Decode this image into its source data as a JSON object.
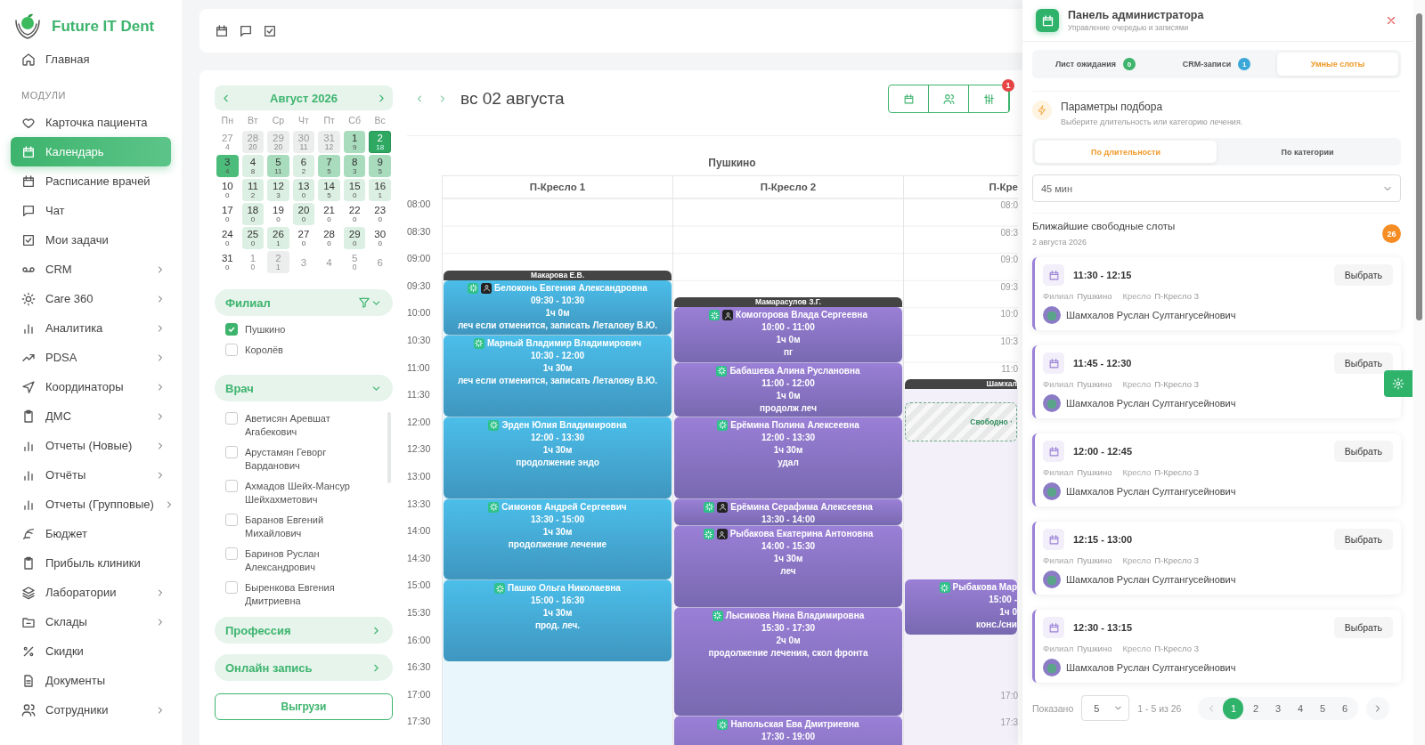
{
  "sidebar": {
    "logo_text": "Future IT Dent",
    "home_item": {
      "label": "Главная",
      "selected": false
    },
    "section_label": "МОДУЛИ",
    "items": [
      {
        "label": "Карточка пациента",
        "selected": false,
        "expandable": false
      },
      {
        "label": "Календарь",
        "selected": true,
        "expandable": false
      },
      {
        "label": "Расписание врачей",
        "selected": false,
        "expandable": false
      },
      {
        "label": "Чат",
        "selected": false,
        "expandable": false
      },
      {
        "label": "Мои задачи",
        "selected": false,
        "expandable": false
      },
      {
        "label": "CRM",
        "selected": false,
        "expandable": true
      },
      {
        "label": "Care 360",
        "selected": false,
        "expandable": true
      },
      {
        "label": "Аналитика",
        "selected": false,
        "expandable": true
      },
      {
        "label": "PDSA",
        "selected": false,
        "expandable": true
      },
      {
        "label": "Координаторы",
        "selected": false,
        "expandable": true
      },
      {
        "label": "ДМС",
        "selected": false,
        "expandable": true
      },
      {
        "label": "Отчеты (Новые)",
        "selected": false,
        "expandable": true
      },
      {
        "label": "Отчёты",
        "selected": false,
        "expandable": true
      },
      {
        "label": "Отчеты (Групповые)",
        "selected": false,
        "expandable": true
      },
      {
        "label": "Бюджет",
        "selected": false,
        "expandable": false
      },
      {
        "label": "Прибыль клиники",
        "selected": false,
        "expandable": false
      },
      {
        "label": "Лаборатории",
        "selected": false,
        "expandable": true
      },
      {
        "label": "Склады",
        "selected": false,
        "expandable": true
      },
      {
        "label": "Скидки",
        "selected": false,
        "expandable": false
      },
      {
        "label": "Документы",
        "selected": false,
        "expandable": false
      },
      {
        "label": "Сотрудники",
        "selected": false,
        "expandable": true
      }
    ]
  },
  "filters": {
    "calendar": {
      "month": "Август 2026",
      "weekdays": [
        "Пн",
        "Вт",
        "Ср",
        "Чт",
        "Пт",
        "Сб",
        "Вс"
      ],
      "days": [
        {
          "day": "27",
          "count": "4",
          "outside": true,
          "selected": false
        },
        {
          "day": "28",
          "count": "20",
          "color": "#eceeed",
          "outside": true,
          "selected": false
        },
        {
          "day": "29",
          "count": "20",
          "color": "#eceeed",
          "outside": true,
          "selected": false
        },
        {
          "day": "30",
          "count": "11",
          "color": "#eceeed",
          "outside": true,
          "selected": false
        },
        {
          "day": "31",
          "count": "12",
          "color": "#eceeed",
          "outside": true,
          "selected": false
        },
        {
          "day": "1",
          "count": "9",
          "color": "#a9dbbd",
          "outside": false,
          "selected": false
        },
        {
          "day": "2",
          "count": "18",
          "color": "#2fa862",
          "outside": false,
          "selected": true
        },
        {
          "day": "3",
          "count": "4",
          "color": "#4cbc7b",
          "outside": false,
          "selected": false
        },
        {
          "day": "4",
          "count": "8",
          "color": "#dcefe3",
          "outside": false,
          "selected": false
        },
        {
          "day": "5",
          "count": "11",
          "color": "#a9dbbd",
          "outside": false,
          "selected": false
        },
        {
          "day": "6",
          "count": "2",
          "color": "#dcefe3",
          "outside": false,
          "selected": false
        },
        {
          "day": "7",
          "count": "5",
          "color": "#a9dbbd",
          "outside": false,
          "selected": false
        },
        {
          "day": "8",
          "count": "3",
          "color": "#a9dbbd",
          "outside": false,
          "selected": false
        },
        {
          "day": "9",
          "count": "5",
          "color": "#a9dbbd",
          "outside": false,
          "selected": false
        },
        {
          "day": "10",
          "count": "0",
          "outside": false,
          "selected": false
        },
        {
          "day": "11",
          "count": "2",
          "color": "#dcefe3",
          "outside": false,
          "selected": false
        },
        {
          "day": "12",
          "count": "3",
          "color": "#dcefe3",
          "outside": false,
          "selected": false
        },
        {
          "day": "13",
          "count": "0",
          "color": "#dcefe3",
          "outside": false,
          "selected": false
        },
        {
          "day": "14",
          "count": "5",
          "color": "#dcefe3",
          "outside": false,
          "selected": false
        },
        {
          "day": "15",
          "count": "0",
          "color": "#dcefe3",
          "outside": false,
          "selected": false
        },
        {
          "day": "16",
          "count": "1",
          "color": "#dcefe3",
          "outside": false,
          "selected": false
        },
        {
          "day": "17",
          "count": "0",
          "outside": false,
          "selected": false
        },
        {
          "day": "18",
          "count": "0",
          "color": "#dcefe3",
          "outside": false,
          "selected": false
        },
        {
          "day": "19",
          "count": "0",
          "outside": false,
          "selected": false
        },
        {
          "day": "20",
          "count": "0",
          "color": "#dcefe3",
          "outside": false,
          "selected": false
        },
        {
          "day": "21",
          "count": "0",
          "outside": false,
          "selected": false
        },
        {
          "day": "22",
          "count": "0",
          "outside": false,
          "selected": false
        },
        {
          "day": "23",
          "count": "0",
          "outside": false,
          "selected": false
        },
        {
          "day": "24",
          "count": "0",
          "outside": false,
          "selected": false
        },
        {
          "day": "25",
          "count": "0",
          "color": "#dcefe3",
          "outside": false,
          "selected": false
        },
        {
          "day": "26",
          "count": "1",
          "color": "#dcefe3",
          "outside": false,
          "selected": false
        },
        {
          "day": "27",
          "count": "0",
          "outside": false,
          "selected": false
        },
        {
          "day": "28",
          "count": "0",
          "outside": false,
          "selected": false
        },
        {
          "day": "29",
          "count": "0",
          "color": "#dcefe3",
          "outside": false,
          "selected": false
        },
        {
          "day": "30",
          "count": "0",
          "outside": false,
          "selected": false
        },
        {
          "day": "31",
          "count": "0",
          "outside": false,
          "selected": false
        },
        {
          "day": "1",
          "count": "0",
          "outside": true,
          "selected": false
        },
        {
          "day": "2",
          "count": "1",
          "color": "#eceeed",
          "outside": true,
          "selected": false
        },
        {
          "day": "3",
          "outside": true,
          "selected": false
        },
        {
          "day": "4",
          "outside": true,
          "selected": false
        },
        {
          "day": "5",
          "count": "0",
          "outside": true,
          "selected": false
        },
        {
          "day": "6",
          "outside": true,
          "selected": false
        }
      ]
    },
    "branch": {
      "title": "Филиал",
      "options": [
        {
          "label": "Пушкино",
          "checked": true
        },
        {
          "label": "Королёв",
          "checked": false
        }
      ]
    },
    "doctor": {
      "title": "Врач",
      "options": [
        {
          "label": "Аветисян Аревшат Агабекович",
          "checked": false
        },
        {
          "label": "Арустамян Геворг Варданович",
          "checked": false
        },
        {
          "label": "Ахмадов Шейх-Мансур Шейхахметович",
          "checked": false
        },
        {
          "label": "Баранов Евгений Михайлович",
          "checked": false
        },
        {
          "label": "Баринов Руслан Александрович",
          "checked": false
        },
        {
          "label": "Быренкова Евгения Дмитриевна",
          "checked": false
        }
      ]
    },
    "sections": [
      "Профессия",
      "Онлайн запись"
    ],
    "export_button": "Выгрузи"
  },
  "calendar": {
    "title": "вс 02 августа",
    "filter_badge": "1",
    "branch": "Пушкино",
    "time_labels": [
      "08:00",
      "08:30",
      "09:00",
      "09:30",
      "10:00",
      "10:30",
      "11:00",
      "11:30",
      "12:00",
      "12:30",
      "13:00",
      "13:30",
      "14:00",
      "14:30",
      "15:00",
      "15:30",
      "16:00",
      "16:30",
      "17:00",
      "17:30"
    ],
    "columns": [
      {
        "name": "П-Кресло 1",
        "color": "#4bbeea",
        "appointments": [
          {
            "kind": "appointment",
            "doctor": "Макарова Е.В.",
            "name": "Белоконь Евгения Александровна",
            "person_icon": true,
            "time": "09:30 - 10:30",
            "duration": "1ч 0м",
            "note": "леч если отменится, записать Леталову В.Ю."
          },
          {
            "kind": "appointment",
            "name": "Марный Владимир Владимирович",
            "person_icon": false,
            "time": "10:30 - 12:00",
            "duration": "1ч 30м",
            "note": "леч если отменится, записать Леталову В.Ю."
          },
          {
            "kind": "appointment",
            "name": "Эрден Юлия Владимировна",
            "person_icon": false,
            "time": "12:00 - 13:30",
            "duration": "1ч 30м",
            "note": "продолжение эндо"
          },
          {
            "kind": "appointment",
            "name": "Симонов Андрей Сергеевич",
            "person_icon": false,
            "time": "13:30 - 15:00",
            "duration": "1ч 30м",
            "note": "продолжение лечение"
          },
          {
            "kind": "appointment",
            "name": "Пашко Ольга Николаевна",
            "person_icon": false,
            "time": "15:00 - 16:30",
            "duration": "1ч 30м",
            "note": "прод. леч."
          }
        ]
      },
      {
        "name": "П-Кресло 2",
        "color": "#9a7fd6",
        "appointments": [
          {
            "kind": "appointment",
            "doctor": "Мамарасулов З.Г.",
            "name": "Комогорова Влада Сергеевна",
            "person_icon": true,
            "time": "10:00 - 11:00",
            "duration": "1ч 0м",
            "note": "пг"
          },
          {
            "kind": "appointment",
            "name": "Бабашева Алина Руслановна",
            "person_icon": false,
            "time": "11:00 - 12:00",
            "duration": "1ч 0м",
            "note": "продолж леч"
          },
          {
            "kind": "appointment",
            "name": "Ерёмина Полина Алексеевна",
            "person_icon": false,
            "time": "12:00 - 13:30",
            "duration": "1ч 30м",
            "note": "удал"
          },
          {
            "kind": "appointment",
            "name": "Ерёмина Серафима Алексеевна",
            "person_icon": true,
            "time": "13:30 - 14:00"
          },
          {
            "kind": "appointment",
            "name": "Рыбакова Екатерина Антоновна",
            "person_icon": true,
            "time": "14:00 - 15:30",
            "duration": "1ч 30м",
            "note": "леч"
          },
          {
            "kind": "appointment",
            "name": "Лысикова Нина Владимировна",
            "person_icon": false,
            "time": "15:30 - 17:30",
            "duration": "2ч 0м",
            "note": "продолжение лечения, скол фронта"
          },
          {
            "kind": "appointment",
            "name": "Напольская Ева Дмитриевна",
            "person_icon": false,
            "time": "17:30 - 19:00"
          }
        ]
      },
      {
        "name": "П-Кре",
        "color": "#9a7fd6",
        "time_marks_top": [
          "08:0",
          "08:3",
          "09:0",
          "09:3",
          "10:0",
          "10:3",
          "11:0"
        ],
        "time_marks_bottom": [
          "17:0",
          "17:3"
        ],
        "appointments": [
          {
            "kind": "free",
            "doctor": "Шамхал",
            "label": "Свободно ·"
          },
          {
            "kind": "appointment",
            "name": "Рыбакова Мар",
            "person_icon": false,
            "time": "15:00 -",
            "duration": "1ч 0",
            "note": "конс./сни"
          }
        ]
      }
    ]
  },
  "panel": {
    "title": "Панель администратора",
    "subtitle": "Управление очередью и записями",
    "tabs": [
      {
        "label": "Лист ожидания",
        "count": "0",
        "color": "#3fb46d",
        "selected": false
      },
      {
        "label": "CRM-записи",
        "count": "1",
        "color": "#3aa7d8",
        "selected": false
      },
      {
        "label": "Умные слоты",
        "selected": true
      }
    ],
    "params_title": "Параметры подбора",
    "params_subtitle": "Выберите длительность или категорию лечения.",
    "modes": [
      {
        "label": "По длительности",
        "selected": true
      },
      {
        "label": "По категории",
        "selected": false
      }
    ],
    "duration": "45 мин",
    "slots_title": "Ближайшие свободные слоты",
    "slots_date": "2 августа 2026",
    "slots_count": "26",
    "slots": [
      {
        "time": "11:30 - 12:15",
        "branch_label": "Филиал",
        "branch": "Пушкино",
        "chair_label": "Кресло",
        "chair": "П-Кресло 3",
        "doctor": "Шамхалов Руслан Султангусейнович",
        "button": "Выбрать"
      },
      {
        "time": "11:45 - 12:30",
        "branch_label": "Филиал",
        "branch": "Пушкино",
        "chair_label": "Кресло",
        "chair": "П-Кресло 3",
        "doctor": "Шамхалов Руслан Султангусейнович",
        "button": "Выбрать"
      },
      {
        "time": "12:00 - 12:45",
        "branch_label": "Филиал",
        "branch": "Пушкино",
        "chair_label": "Кресло",
        "chair": "П-Кресло 3",
        "doctor": "Шамхалов Руслан Султангусейнович",
        "button": "Выбрать"
      },
      {
        "time": "12:15 - 13:00",
        "branch_label": "Филиал",
        "branch": "Пушкино",
        "chair_label": "Кресло",
        "chair": "П-Кресло 3",
        "doctor": "Шамхалов Руслан Султангусейнович",
        "button": "Выбрать"
      },
      {
        "time": "12:30 - 13:15",
        "branch_label": "Филиал",
        "branch": "Пушкино",
        "chair_label": "Кресло",
        "chair": "П-Кресло 3",
        "doctor": "Шамхалов Руслан Султангусейнович",
        "button": "Выбрать"
      }
    ],
    "pagination": {
      "shown_label": "Показано",
      "page_size": "5",
      "range": "1 - 5 из 26",
      "pages": [
        {
          "label": "1",
          "selected": true
        },
        {
          "label": "2",
          "selected": false
        },
        {
          "label": "3",
          "selected": false
        },
        {
          "label": "4",
          "selected": false
        },
        {
          "label": "5",
          "selected": false
        },
        {
          "label": "6",
          "selected": false
        }
      ]
    }
  }
}
